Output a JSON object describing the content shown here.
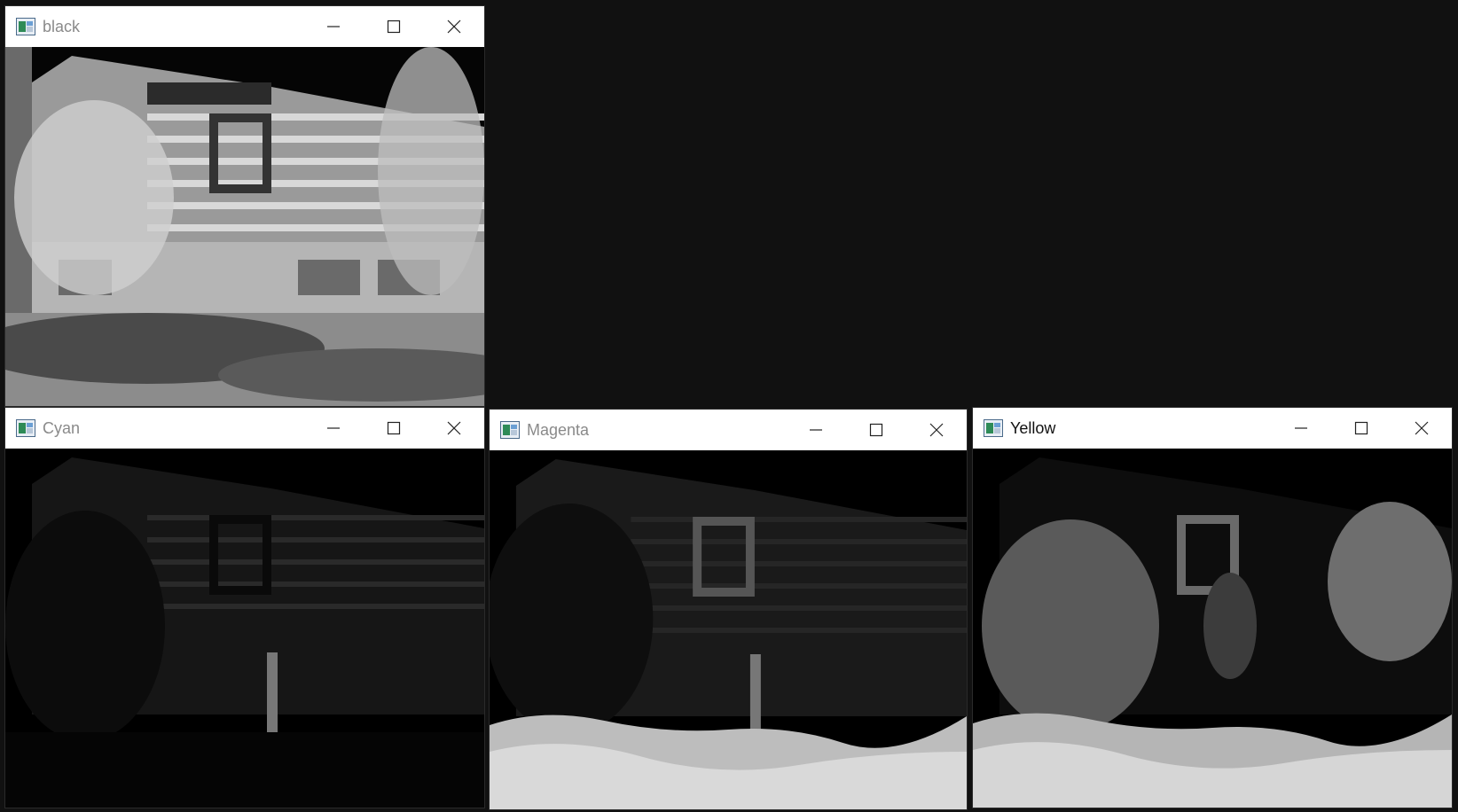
{
  "desktop": {
    "background": "#111111"
  },
  "windows": {
    "black": {
      "title": "black"
    },
    "cyan": {
      "title": "Cyan"
    },
    "magenta": {
      "title": "Magenta"
    },
    "yellow": {
      "title": "Yellow"
    }
  },
  "icons": {
    "app": "window-app-icon",
    "minimize": "minimize-icon",
    "maximize": "maximize-icon",
    "close": "close-icon"
  }
}
